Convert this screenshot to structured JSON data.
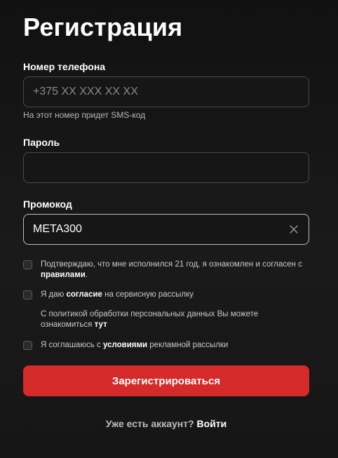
{
  "form": {
    "title": "Регистрация",
    "phone": {
      "label": "Номер телефона",
      "value": "",
      "placeholder": "+375 XX XXX XX XX",
      "hint": "На этот номер придет SMS-код"
    },
    "password": {
      "label": "Пароль",
      "value": "",
      "placeholder": ""
    },
    "promo": {
      "label": "Промокод",
      "value": "META300",
      "clear_icon": "close-icon"
    },
    "consents": [
      {
        "checked": false,
        "text_before": "Подтверждаю, что мне исполнился 21 год, я ознакомлен и согласен с ",
        "link": "правилами",
        "text_after": "."
      },
      {
        "checked": false,
        "text_before": "Я даю ",
        "link": "согласие",
        "text_after": " на сервисную рассылку"
      },
      {
        "checked": false,
        "text_before": "Я соглашаюсь с ",
        "link": "условиями",
        "text_after": " рекламной рассылки"
      }
    ],
    "privacy_note": {
      "text_before": "С политикой обработки персональных данных Вы можете ознакомиться ",
      "link": "тут"
    },
    "submit_label": "Зарегистрироваться",
    "login_prompt": "Уже есть аккаунт?",
    "login_link": "Войти"
  },
  "colors": {
    "background": "#141414",
    "accent": "#d42a2a",
    "field_border": "#4a4a4a",
    "text_muted": "#c9c9c9"
  }
}
